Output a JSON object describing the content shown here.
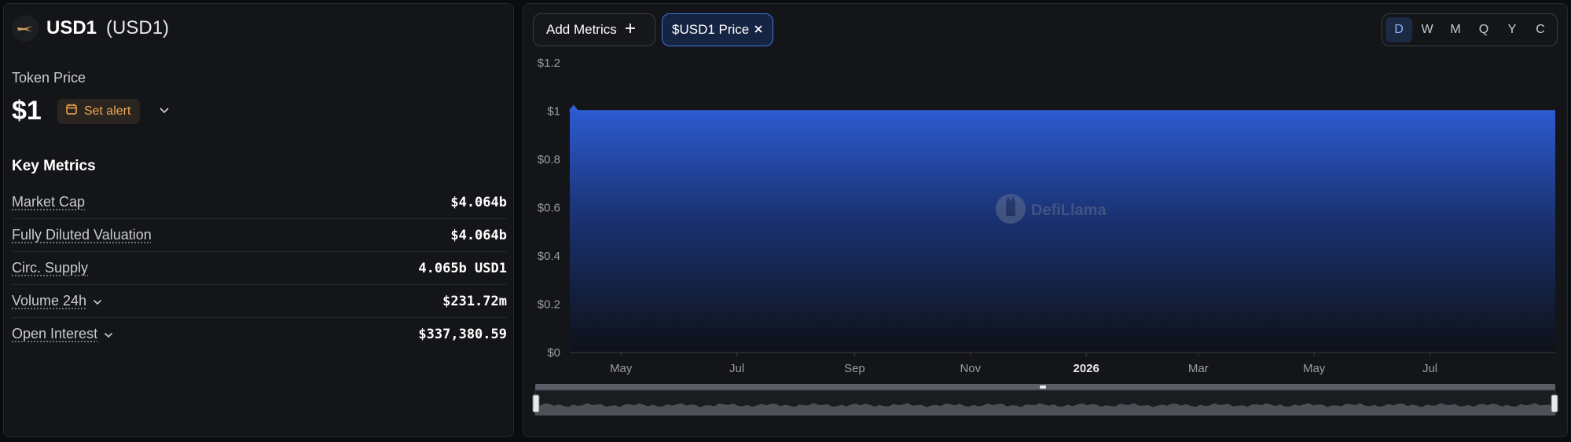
{
  "token": {
    "name": "USD1",
    "symbol": "(USD1)"
  },
  "price": {
    "label": "Token Price",
    "value": "$1",
    "alert_label": "Set alert"
  },
  "key_metrics": {
    "title": "Key Metrics",
    "rows": [
      {
        "label": "Market Cap",
        "value": "$4.064b",
        "has_dropdown": false
      },
      {
        "label": "Fully Diluted Valuation",
        "value": "$4.064b",
        "has_dropdown": false
      },
      {
        "label": "Circ. Supply",
        "value": "4.065b USD1",
        "has_dropdown": false
      },
      {
        "label": "Volume 24h",
        "value": "$231.72m",
        "has_dropdown": true
      },
      {
        "label": "Open Interest",
        "value": "$337,380.59",
        "has_dropdown": true
      }
    ]
  },
  "toolbar": {
    "add_metrics_label": "Add Metrics",
    "active_metric_label": "$USD1 Price"
  },
  "periods": {
    "options": [
      "D",
      "W",
      "M",
      "Q",
      "Y",
      "C"
    ],
    "selected": "D"
  },
  "watermark": "DefiLlama",
  "colors": {
    "accent": "#3d74e0",
    "series": "#2f5fd6",
    "alert": "#f0a94d"
  },
  "chart_data": {
    "type": "area",
    "title": "",
    "xlabel": "",
    "ylabel": "",
    "ylim": [
      0,
      1.2
    ],
    "y_ticks": [
      "$0",
      "$0.2",
      "$0.4",
      "$0.6",
      "$0.8",
      "$1",
      "$1.2"
    ],
    "y_tick_values": [
      0,
      0.2,
      0.4,
      0.6,
      0.8,
      1.0,
      1.2
    ],
    "x_ticks": [
      "May",
      "Jul",
      "Sep",
      "Nov",
      "2026",
      "Mar",
      "May",
      "Jul"
    ],
    "x_tick_dates": [
      "2025-05-01",
      "2025-07-01",
      "2025-09-01",
      "2025-11-01",
      "2026-01-01",
      "2026-03-01",
      "2026-05-01",
      "2026-07-01"
    ],
    "x_range": [
      "2025-04-04",
      "2026-09-05"
    ],
    "grid": false,
    "series": [
      {
        "values_x": [
          "2025-04-04",
          "2025-04-06",
          "2025-04-08",
          "2025-04-15",
          "2025-05-01",
          "2025-07-01",
          "2025-09-01",
          "2025-11-01",
          "2026-01-01",
          "2026-03-01",
          "2026-05-01",
          "2026-07-01",
          "2026-09-05"
        ],
        "values_y": [
          1.0,
          1.02,
          1.0,
          1.0,
          1.0,
          1.0,
          1.0,
          1.0,
          1.0,
          1.0,
          1.0,
          1.0,
          1.0
        ]
      }
    ]
  }
}
